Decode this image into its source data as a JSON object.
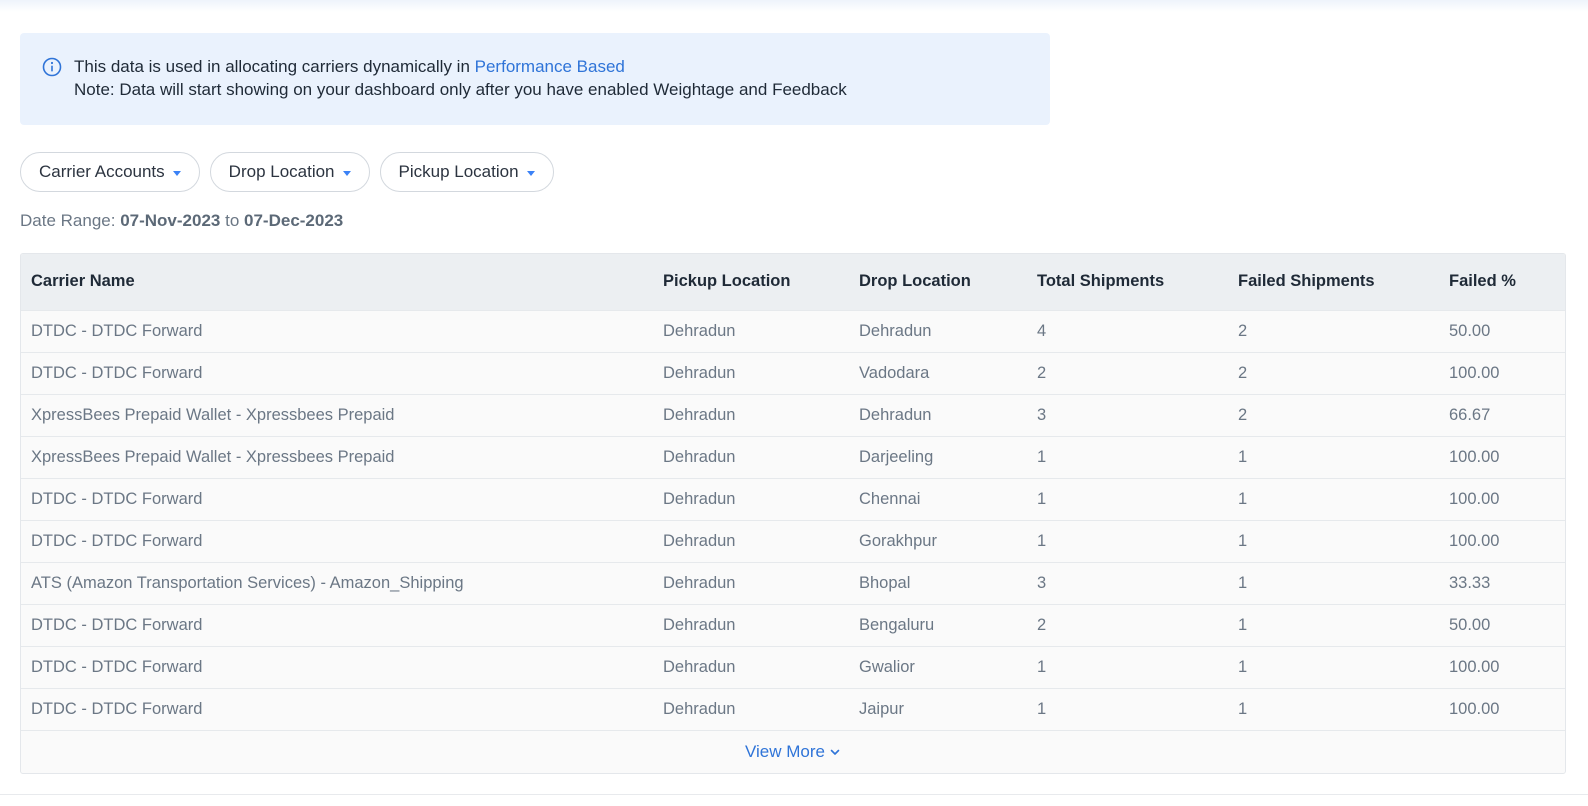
{
  "banner": {
    "line1_prefix": "This data is used in allocating carriers dynamically in",
    "line1_link": "Performance Based",
    "line2": "Note: Data will start showing on your dashboard only after you have enabled Weightage and Feedback",
    "icon": "info-circle-icon"
  },
  "filters": [
    {
      "label": "Carrier Accounts"
    },
    {
      "label": "Drop Location"
    },
    {
      "label": "Pickup Location"
    }
  ],
  "date_range": {
    "label": "Date Range:",
    "from": "07-Nov-2023",
    "to_word": "to",
    "to": "07-Dec-2023"
  },
  "table": {
    "headers": [
      "Carrier Name",
      "Pickup Location",
      "Drop Location",
      "Total Shipments",
      "Failed Shipments",
      "Failed %"
    ],
    "rows": [
      [
        "DTDC - DTDC Forward",
        "Dehradun",
        "Dehradun",
        "4",
        "2",
        "50.00"
      ],
      [
        "DTDC - DTDC Forward",
        "Dehradun",
        "Vadodara",
        "2",
        "2",
        "100.00"
      ],
      [
        "XpressBees Prepaid Wallet - Xpressbees Prepaid",
        "Dehradun",
        "Dehradun",
        "3",
        "2",
        "66.67"
      ],
      [
        "XpressBees Prepaid Wallet - Xpressbees Prepaid",
        "Dehradun",
        "Darjeeling",
        "1",
        "1",
        "100.00"
      ],
      [
        "DTDC - DTDC Forward",
        "Dehradun",
        "Chennai",
        "1",
        "1",
        "100.00"
      ],
      [
        "DTDC - DTDC Forward",
        "Dehradun",
        "Gorakhpur",
        "1",
        "1",
        "100.00"
      ],
      [
        "ATS (Amazon Transportation Services) - Amazon_Shipping",
        "Dehradun",
        "Bhopal",
        "3",
        "1",
        "33.33"
      ],
      [
        "DTDC - DTDC Forward",
        "Dehradun",
        "Bengaluru",
        "2",
        "1",
        "50.00"
      ],
      [
        "DTDC - DTDC Forward",
        "Dehradun",
        "Gwalior",
        "1",
        "1",
        "100.00"
      ],
      [
        "DTDC - DTDC Forward",
        "Dehradun",
        "Jaipur",
        "1",
        "1",
        "100.00"
      ]
    ],
    "view_more": "View More"
  },
  "colors": {
    "accent": "#2f74d8",
    "banner_bg": "#eaf2fd",
    "header_bg": "#eceff2"
  }
}
